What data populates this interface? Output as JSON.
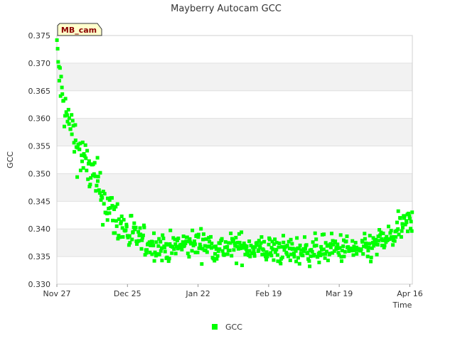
{
  "chart_data": {
    "type": "scatter",
    "title": "Mayberry Autocam GCC",
    "xlabel": "Time",
    "ylabel": "GCC",
    "site_tag": "MB_cam",
    "x_ticks": [
      "Nov 27",
      "Dec 25",
      "Jan 22",
      "Feb 19",
      "Mar 19",
      "Apr 16"
    ],
    "x_range": [
      "2015-11-27",
      "2016-04-16"
    ],
    "ylim": [
      0.33,
      0.375
    ],
    "y_ticks": [
      "0.330",
      "0.335",
      "0.340",
      "0.345",
      "0.350",
      "0.355",
      "0.360",
      "0.365",
      "0.370",
      "0.375"
    ],
    "grid": "alternating horizontal bands",
    "legend": "bottom-center",
    "series": [
      {
        "name": "GCC",
        "color": "#00ff00",
        "trend": [
          {
            "x": "2015-11-27",
            "y": 0.372
          },
          {
            "x": "2015-11-29",
            "y": 0.364
          },
          {
            "x": "2015-12-01",
            "y": 0.36
          },
          {
            "x": "2015-12-03",
            "y": 0.358
          },
          {
            "x": "2015-12-05",
            "y": 0.355
          },
          {
            "x": "2015-12-08",
            "y": 0.352
          },
          {
            "x": "2015-12-12",
            "y": 0.349
          },
          {
            "x": "2015-12-16",
            "y": 0.345
          },
          {
            "x": "2015-12-20",
            "y": 0.342
          },
          {
            "x": "2015-12-25",
            "y": 0.3395
          },
          {
            "x": "2016-01-01",
            "y": 0.3375
          },
          {
            "x": "2016-01-10",
            "y": 0.3365
          },
          {
            "x": "2016-01-22",
            "y": 0.3375
          },
          {
            "x": "2016-02-01",
            "y": 0.3365
          },
          {
            "x": "2016-02-10",
            "y": 0.3368
          },
          {
            "x": "2016-02-19",
            "y": 0.3362
          },
          {
            "x": "2016-02-28",
            "y": 0.336
          },
          {
            "x": "2016-03-08",
            "y": 0.3362
          },
          {
            "x": "2016-03-19",
            "y": 0.3365
          },
          {
            "x": "2016-03-28",
            "y": 0.336
          },
          {
            "x": "2016-04-03",
            "y": 0.3375
          },
          {
            "x": "2016-04-08",
            "y": 0.3385
          },
          {
            "x": "2016-04-12",
            "y": 0.3405
          },
          {
            "x": "2016-04-16",
            "y": 0.3412
          }
        ]
      }
    ]
  }
}
